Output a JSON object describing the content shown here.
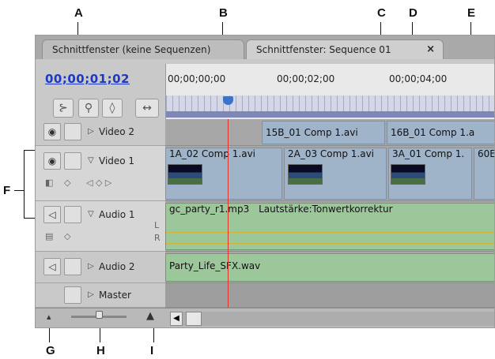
{
  "callouts": [
    "A",
    "B",
    "C",
    "D",
    "E",
    "F",
    "G",
    "H",
    "I"
  ],
  "tabs": [
    "Schnittfenster (keine Sequenzen)",
    "Schnittfenster: Sequence 01"
  ],
  "tab_close": "×",
  "timecode": "00;00;01;02",
  "ruler_labels": [
    "00;00;00;00",
    "00;00;02;00",
    "00;00;04;00"
  ],
  "tracks": {
    "video2": {
      "name": "Video 2",
      "clips": [
        "15B_01 Comp 1.avi",
        "16B_01 Comp 1.a"
      ]
    },
    "video1": {
      "name": "Video 1",
      "clips": [
        "1A_02 Comp 1.avi",
        "2A_03 Comp 1.avi",
        "3A_01 Comp 1.",
        "60E"
      ]
    },
    "audio1": {
      "name": "Audio 1",
      "clip": "gc_party_r1.mp3",
      "effect": "Lautstärke:Tonwertkorrektur",
      "channels": [
        "L",
        "R"
      ]
    },
    "audio2": {
      "name": "Audio 2",
      "clip": "Party_Life_SFX.wav"
    },
    "master": {
      "name": "Master"
    }
  },
  "icons": {
    "eye": "◉",
    "triangle_right": "▷",
    "triangle_down": "▽",
    "speaker": "◁",
    "arrow_left": "◀",
    "tool_snap": "⊱",
    "tool_marker": "⚲",
    "tool_drop": "◊",
    "tool_link": "↔"
  },
  "colors": {
    "accent": "#1d39c4",
    "playhead": "#e0342b",
    "video_clip": "#9fb3c9",
    "audio_clip": "#9cc79b"
  }
}
